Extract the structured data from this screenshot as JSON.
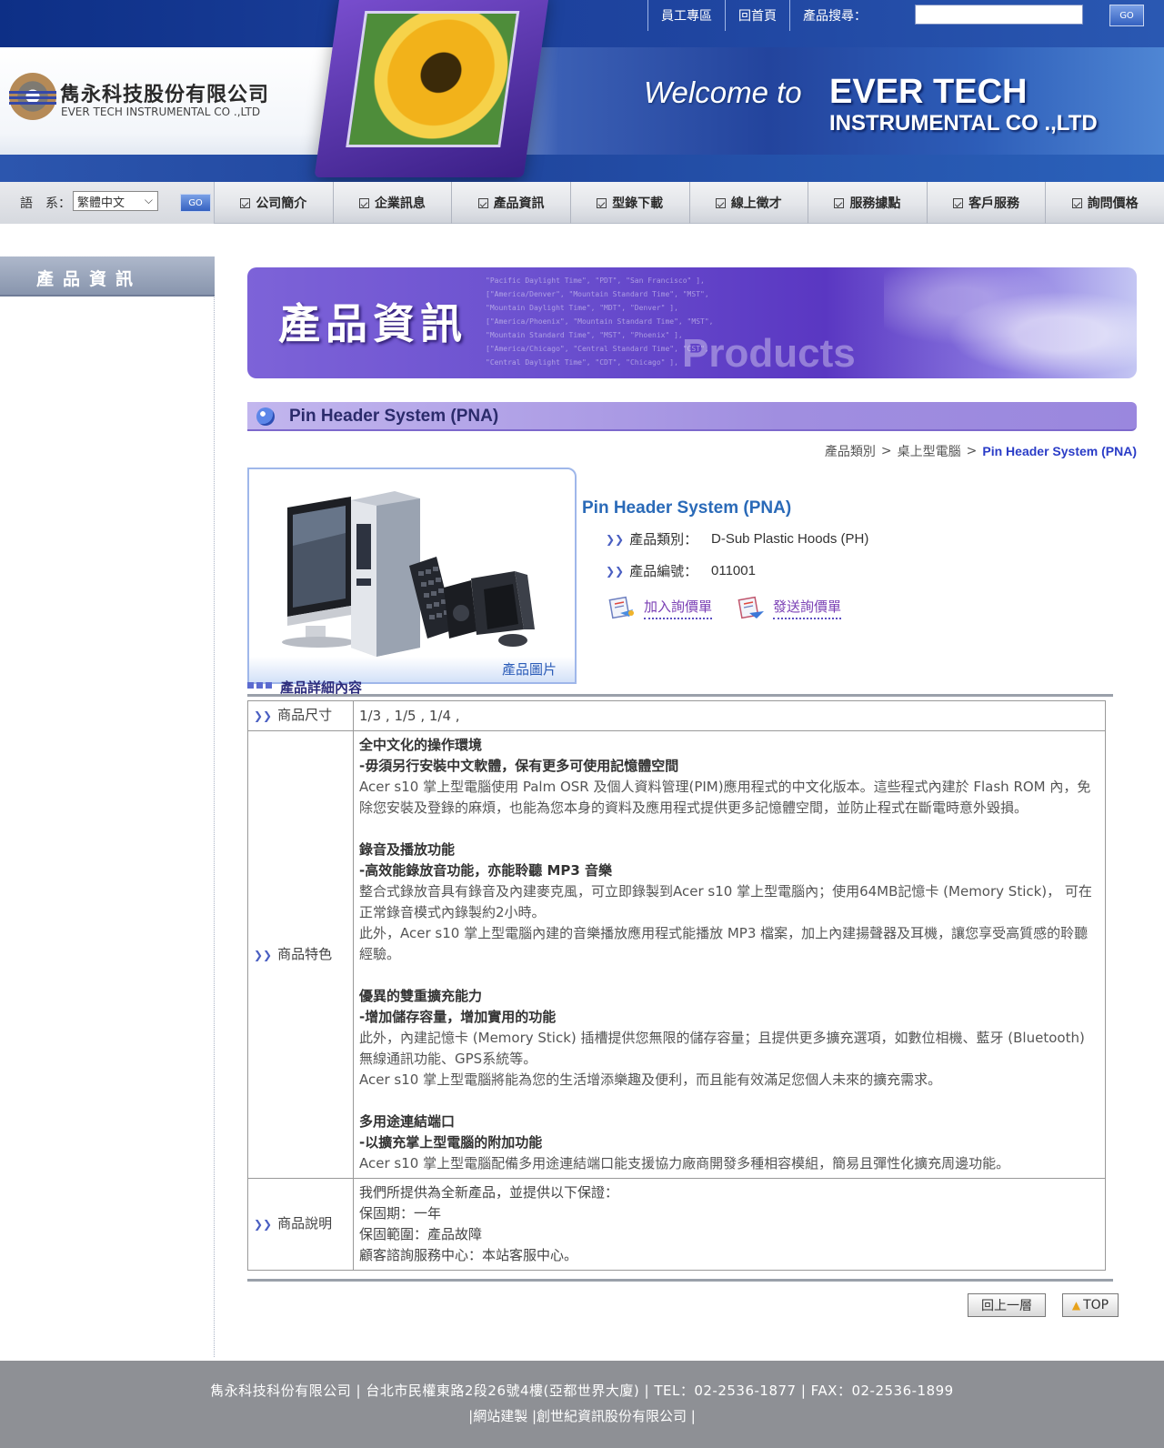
{
  "header": {
    "company_cn": "雋永科技股份有限公司",
    "company_en": "EVER TECH INSTRUMENTAL CO .,LTD",
    "welcome": "Welcome to",
    "brand_line1": "EVER TECH",
    "brand_line2": "INSTRUMENTAL CO .,LTD",
    "top_links": [
      "員工專區",
      "回首頁"
    ],
    "search_label": "產品搜尋：",
    "search_value": "",
    "go_label": "GO"
  },
  "language": {
    "label": "語　系：",
    "selected": "繁體中文",
    "go_label": "GO"
  },
  "nav": {
    "items": [
      "公司簡介",
      "企業訊息",
      "產品資訊",
      "型錄下載",
      "線上徵才",
      "服務據點",
      "客戶服務",
      "詢問價格"
    ]
  },
  "sidebar": {
    "title": "產品資訊"
  },
  "banner": {
    "title": "產品資訊",
    "word": "Products",
    "bg_lines": [
      "\"Pacific Daylight Time\", \"PDT\", \"San Francisco\" ],",
      "[\"America/Denver\", \"Mountain Standard Time\", \"MST\",",
      "\"Mountain Daylight Time\", \"MDT\", \"Denver\" ],",
      "[\"America/Phoenix\", \"Mountain Standard Time\", \"MST\",",
      "\"Mountain Standard Time\", \"MST\", \"Phoenix\" ],",
      "[\"America/Chicago\", \"Central Standard Time\", \"CST\",",
      "\"Central Daylight Time\", \"CDT\", \"Chicago\" ],"
    ]
  },
  "section": {
    "title": "Pin Header System (PNA)"
  },
  "breadcrumb": {
    "items": [
      "產品類別",
      "桌上型電腦",
      "Pin Header System (PNA)"
    ],
    "separator": ">"
  },
  "product": {
    "image_label": "產品圖片",
    "title": "Pin Header System (PNA)",
    "category_label": "產品類別：",
    "category_value": "D-Sub Plastic Hoods (PH)",
    "code_label": "產品編號：",
    "code_value": "011001",
    "add_button": "加入詢價單",
    "send_button": "發送詢價單"
  },
  "details": {
    "title": "產品詳細內容",
    "size_label": "商品尺寸",
    "size_value": "1/3 , 1/5 , 1/4 ,",
    "features_label": "商品特色",
    "features": [
      {
        "title": "全中文化的操作環境",
        "subtitle": "-毋須另行安裝中文軟體，保有更多可使用記憶體空間",
        "body": [
          "Acer s10 掌上型電腦使用 Palm OSR 及個人資料管理(PIM)應用程式的中文化版本。這些程式內建於 Flash ROM 內，免除您安裝及登錄的麻煩，也能為您本身的資料及應用程式提供更多記憶體空間，並防止程式在斷電時意外毀損。"
        ]
      },
      {
        "title": "錄音及播放功能",
        "subtitle": "-高效能錄放音功能，亦能聆聽 MP3 音樂",
        "body": [
          "整合式錄放音具有錄音及內建麥克風，可立即錄製到Acer s10 掌上型電腦內；使用64MB記憶卡 (Memory Stick)， 可在正常錄音模式內錄製約2小時。",
          "此外，Acer s10 掌上型電腦內建的音樂播放應用程式能播放 MP3 檔案，加上內建揚聲器及耳機，讓您享受高質感的聆聽經驗。"
        ]
      },
      {
        "title": "優異的雙重擴充能力",
        "subtitle": "-增加儲存容量，增加實用的功能",
        "body": [
          "此外，內建記憶卡 (Memory Stick) 插槽提供您無限的儲存容量；且提供更多擴充選項，如數位相機、藍牙 (Bluetooth) 無線通訊功能、GPS系統等。",
          "Acer s10 掌上型電腦將能為您的生活增添樂趣及便利，而且能有效滿足您個人未來的擴充需求。"
        ]
      },
      {
        "title": "多用途連結端口",
        "subtitle": "-以擴充掌上型電腦的附加功能",
        "body": [
          "Acer s10 掌上型電腦配備多用途連結端口能支援協力廠商開發多種相容模組，簡易且彈性化擴充周邊功能。"
        ]
      }
    ],
    "desc_label": "商品說明",
    "desc_lines": [
      "我們所提供為全新產品，並提供以下保證：",
      "保固期：一年",
      "保固範圍：產品故障",
      "顧客諮詢服務中心：本站客服中心。"
    ]
  },
  "buttons": {
    "back": "回上一層",
    "top": "TOP"
  },
  "footer": {
    "line1": "雋永科技科份有限公司 | 台北市民權東路2段26號4樓(亞都世界大廈) | TEL：02-2536-1877 | FAX：02-2536-1899",
    "line2": "|網站建製 |創世紀資訊股份有限公司 |"
  }
}
